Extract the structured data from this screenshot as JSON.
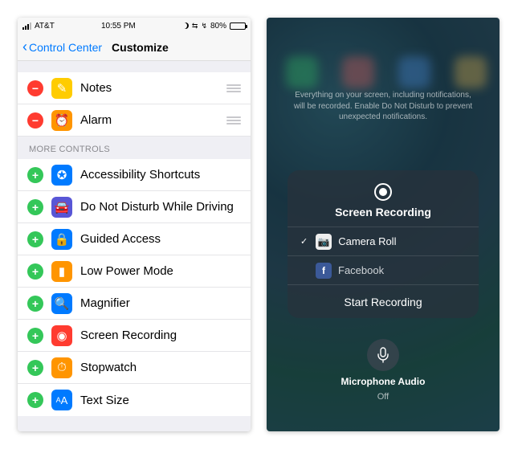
{
  "left": {
    "status": {
      "carrier": "AT&T",
      "time": "10:55 PM",
      "battery_pct": "80%"
    },
    "nav": {
      "back": "Control Center",
      "title": "Customize"
    },
    "included": [
      {
        "label": "Notes",
        "icon": "notes"
      },
      {
        "label": "Alarm",
        "icon": "alarm"
      }
    ],
    "more_header": "MORE CONTROLS",
    "more": [
      {
        "label": "Accessibility Shortcuts",
        "icon": "access"
      },
      {
        "label": "Do Not Disturb While Driving",
        "icon": "dnd"
      },
      {
        "label": "Guided Access",
        "icon": "guided"
      },
      {
        "label": "Low Power Mode",
        "icon": "lowpwr"
      },
      {
        "label": "Magnifier",
        "icon": "mag"
      },
      {
        "label": "Screen Recording",
        "icon": "rec"
      },
      {
        "label": "Stopwatch",
        "icon": "stop"
      },
      {
        "label": "Text Size",
        "icon": "text"
      }
    ]
  },
  "right": {
    "hint": "Everything on your screen, including notifications, will be recorded. Enable Do Not Disturb to prevent unexpected notifications.",
    "sheet_title": "Screen Recording",
    "destinations": [
      {
        "label": "Camera Roll",
        "selected": true,
        "icon": "camera"
      },
      {
        "label": "Facebook",
        "selected": false,
        "icon": "fb"
      }
    ],
    "start": "Start Recording",
    "mic_label": "Microphone Audio",
    "mic_state": "Off"
  }
}
